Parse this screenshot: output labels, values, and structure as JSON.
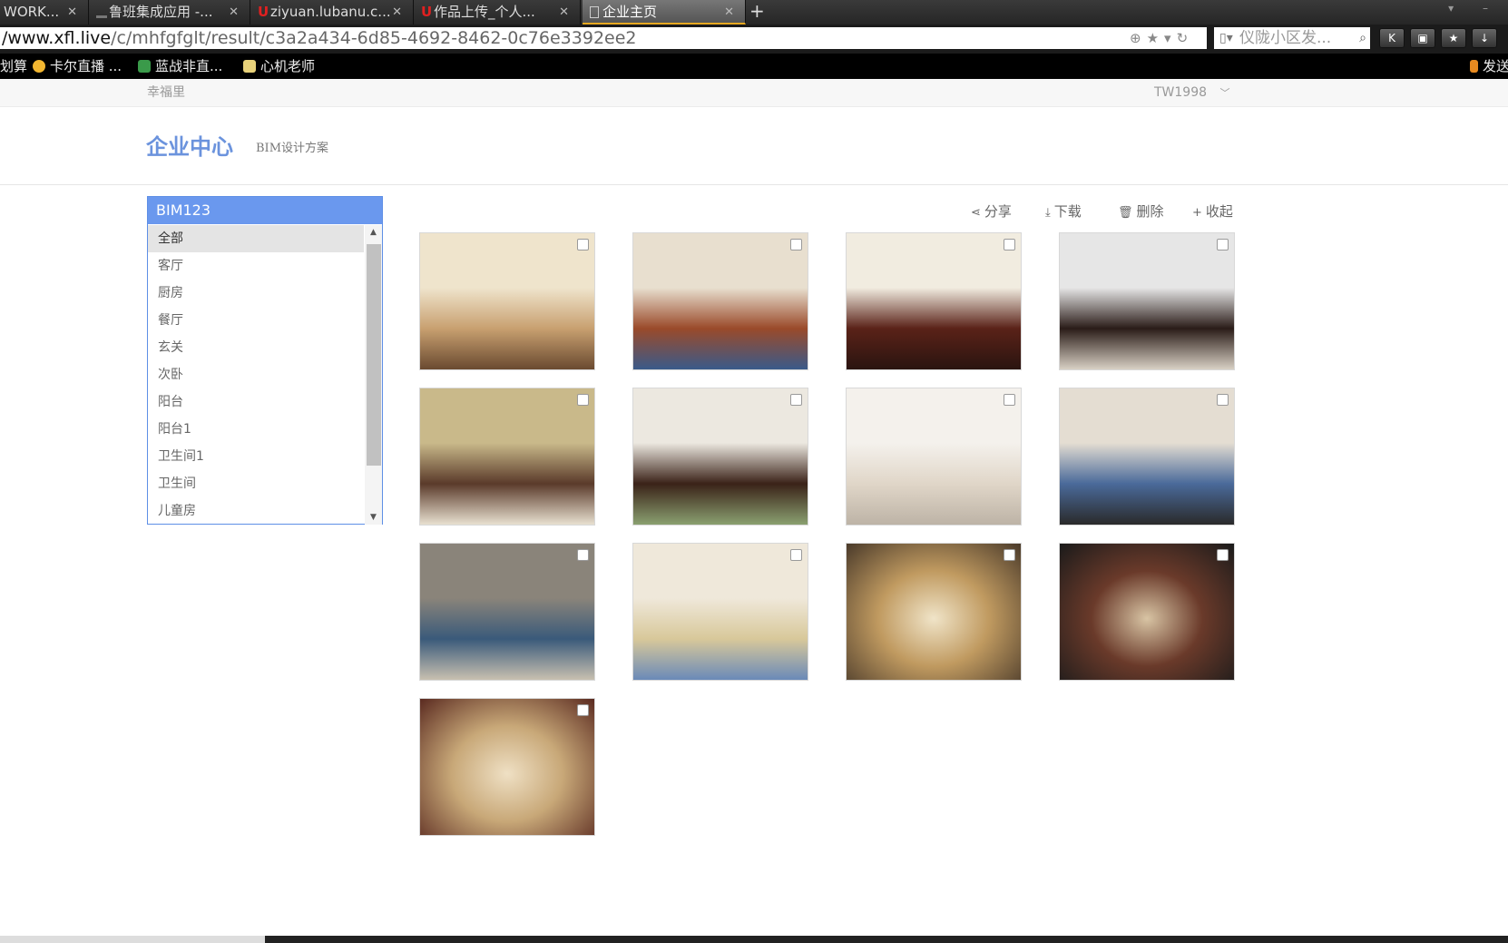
{
  "browser": {
    "tabs": [
      {
        "label": "WORK...",
        "active": false
      },
      {
        "label": "鲁班集成应用 -...",
        "active": false
      },
      {
        "label": "ziyuan.lubanu.c...",
        "active": false
      },
      {
        "label": "作品上传_个人...",
        "active": false
      },
      {
        "label": "企业主页",
        "active": true
      }
    ],
    "new_tab": "+",
    "url_host": "/www.xfl.live",
    "url_path": "/c/mhfgfglt/result/c3a2a434-6d85-4692-8462-0c76e3392ee2",
    "search_placeholder": "仪陇小区发...",
    "bookmarks": [
      "划算",
      "卡尔直播 ...",
      "蓝战非直...",
      "心机老师"
    ],
    "bookmark_right": "发送"
  },
  "page": {
    "community": "幸福里",
    "user": "TW1998",
    "title": "企业中心",
    "subtitle": "BIM设计方案"
  },
  "panel": {
    "project": "BIM123",
    "categories": [
      "全部",
      "客厅",
      "厨房",
      "餐厅",
      "玄关",
      "次卧",
      "阳台",
      "阳台1",
      "卫生间1",
      "卫生间",
      "儿童房"
    ],
    "selected_index": 0
  },
  "toolbar": {
    "share": "分享",
    "download": "下载",
    "delete": "删除",
    "collapse": "收起"
  },
  "images": [
    {
      "room": "living-room",
      "colors": [
        "#efe4cc",
        "#c8a070",
        "#6a4a30"
      ]
    },
    {
      "room": "kitchen",
      "colors": [
        "#e8dfcf",
        "#9a4a2a",
        "#3a5a8a"
      ]
    },
    {
      "room": "dining-room",
      "colors": [
        "#f1ece0",
        "#5a2218",
        "#2a1410"
      ]
    },
    {
      "room": "entrance",
      "colors": [
        "#e6e6e6",
        "#2a1c18",
        "#d8d0c4"
      ]
    },
    {
      "room": "bedroom",
      "colors": [
        "#c9b98a",
        "#5a3a2a",
        "#e8e0d0"
      ]
    },
    {
      "room": "balcony",
      "colors": [
        "#ece8e0",
        "#3a2218",
        "#8aa070"
      ]
    },
    {
      "room": "balcony",
      "colors": [
        "#f4f1ec",
        "#e0d6c8",
        "#bdb3a6"
      ]
    },
    {
      "room": "bathroom",
      "colors": [
        "#e4ddd2",
        "#4a6a9a",
        "#2a2a2a"
      ]
    },
    {
      "room": "bathroom",
      "colors": [
        "#8a847a",
        "#3a5a7a",
        "#c8c0b0"
      ]
    },
    {
      "room": "kids-room",
      "colors": [
        "#efe8da",
        "#d8c89a",
        "#6a8ab8"
      ]
    },
    {
      "room": "panorama",
      "colors": [
        "#f0e4c8",
        "#c09a60",
        "#4a3a2a"
      ]
    },
    {
      "room": "panorama",
      "colors": [
        "#d8c4a4",
        "#6a3a2a",
        "#1a1a1a"
      ]
    },
    {
      "room": "panorama",
      "colors": [
        "#efe0c4",
        "#c8a878",
        "#5a2a20"
      ]
    }
  ]
}
